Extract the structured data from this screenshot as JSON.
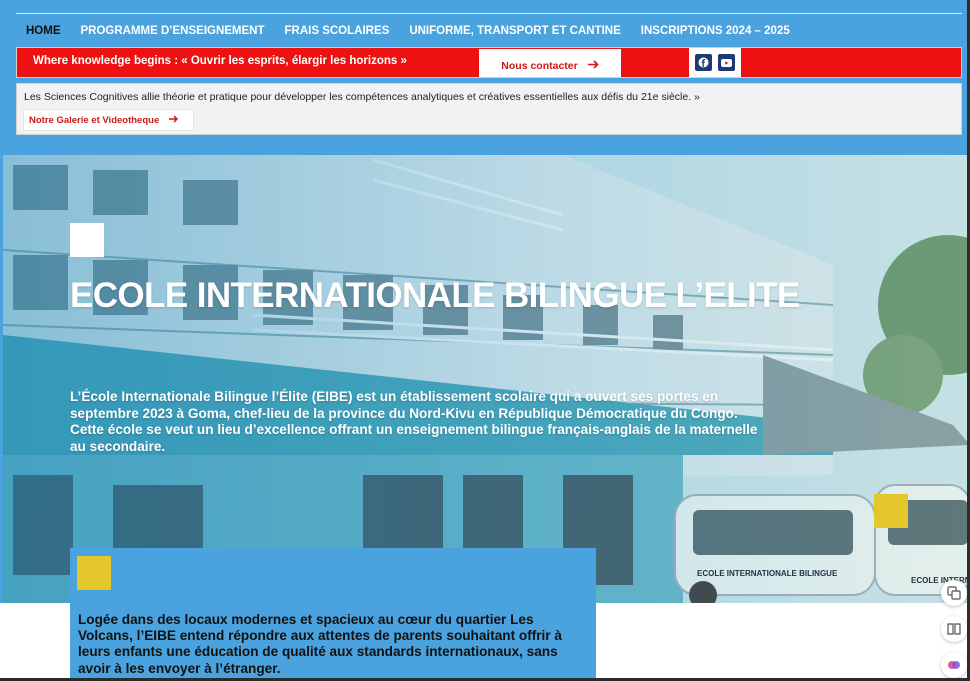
{
  "nav": {
    "items": [
      {
        "label": "HOME",
        "active": true
      },
      {
        "label": "PROGRAMME D’ENSEIGNEMENT",
        "active": false
      },
      {
        "label": "FRAIS SCOLAIRES",
        "active": false
      },
      {
        "label": "UNIFORME, TRANSPORT ET CANTINE",
        "active": false
      },
      {
        "label": "INSCRIPTIONS 2024 – 2025",
        "active": false
      }
    ]
  },
  "banner": {
    "tagline": "Where knowledge begins : « Ouvrir les esprits, élargir les horizons »",
    "contact_label": "Nous contacter",
    "social_icons": [
      "facebook-icon",
      "youtube-icon"
    ]
  },
  "info": {
    "text": "Les Sciences Cognitives allie théorie et pratique pour développer les compétences analytiques et créatives essentielles aux défis du 21e siècle. »",
    "gallery_label": "Notre Galerie et Videotheque"
  },
  "hero": {
    "title": "ECOLE INTERNATIONALE BILINGUE L’ELITE",
    "description": "L’École Internationale Bilingue l’Élite (EIBE) est un établissement scolaire qui a ouvert ses portes en septembre 2023 à Goma, chef-lieu de la province du Nord-Kivu en République Démocratique du Congo. Cette école se veut un lieu d’excellence offrant un enseignement bilingue français-anglais de la maternelle au secondaire.",
    "bus_label_1": "ECOLE INTERNATIONALE BILINGUE",
    "bus_label_2": "ECOLE INTERNATIONALE"
  },
  "about": {
    "text": "Logée dans des locaux modernes et spacieux au cœur du quartier Les Volcans, l’EIBE entend répondre aux attentes de parents souhaitant offrir à leurs enfants une éducation de qualité aux standards internationaux, sans avoir à les envoyer à l’étranger."
  },
  "colors": {
    "primary_blue": "#4aa3de",
    "banner_red": "#ee1111",
    "accent_yellow": "#e3c72b",
    "link_red": "#c81a1a"
  }
}
